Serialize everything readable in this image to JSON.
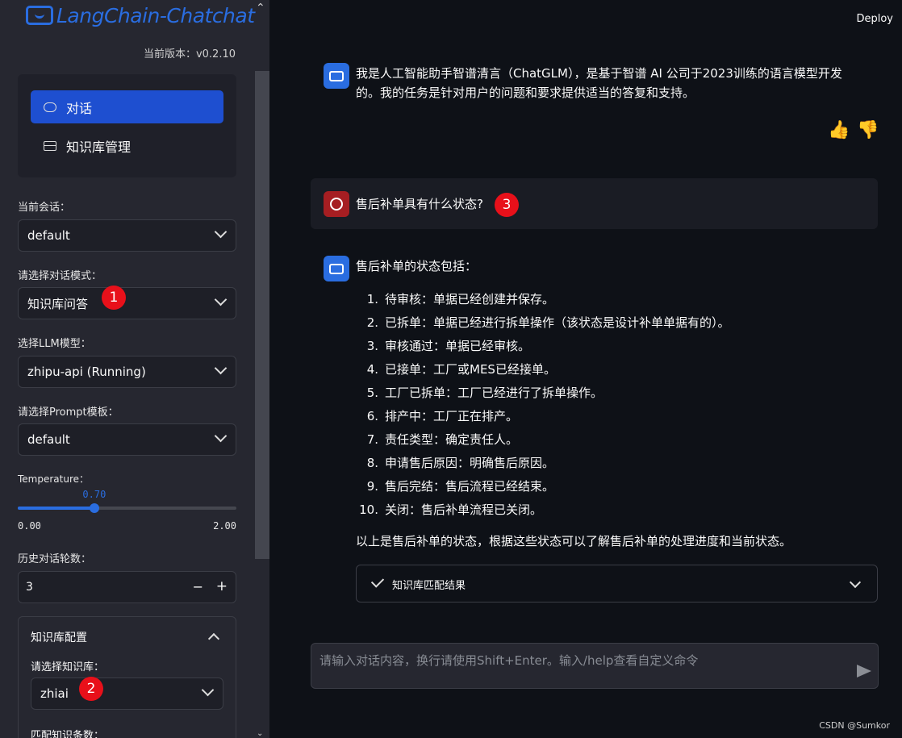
{
  "app": {
    "logo_text": "LangChain-Chatchat",
    "version": "当前版本：v0.2.10",
    "deploy_label": "Deploy"
  },
  "sidebar": {
    "nav": [
      {
        "label": "对话",
        "active": true,
        "icon": "chat-bubble-icon"
      },
      {
        "label": "知识库管理",
        "active": false,
        "icon": "database-icon"
      }
    ],
    "current_session_label": "当前会话：",
    "current_session_value": "default",
    "mode_label": "请选择对话模式：",
    "mode_value": "知识库问答",
    "llm_label": "选择LLM模型：",
    "llm_value": "zhipu-api (Running)",
    "prompt_label": "请选择Prompt模板：",
    "prompt_value": "default",
    "temperature_label": "Temperature：",
    "temperature_value": "0.70",
    "temperature_min": "0.00",
    "temperature_max": "2.00",
    "temperature_fraction": 0.35,
    "history_label": "历史对话轮数：",
    "history_value": "3",
    "minus": "−",
    "plus": "+",
    "kb_config_title": "知识库配置",
    "kb_select_label": "请选择知识库：",
    "kb_value": "zhiai",
    "kb_match_label": "匹配知识条数："
  },
  "badges": [
    "1",
    "2",
    "3"
  ],
  "chat": {
    "intro": "我是人工智能助手智谱清言（ChatGLM），是基于智谱 AI 公司于2023训练的语言模型开发的。我的任务是针对用户的问题和要求提供适当的答复和支持。",
    "user_question": "售后补单具有什么状态?",
    "answer_intro": "售后补单的状态包括：",
    "answer_items": [
      {
        "num": "1.",
        "text": "待审核：单据已经创建并保存。"
      },
      {
        "num": "2.",
        "text": "已拆单：单据已经进行拆单操作（该状态是设计补单单据有的）。"
      },
      {
        "num": "3.",
        "text": "审核通过：单据已经审核。"
      },
      {
        "num": "4.",
        "text": "已接单：工厂或MES已经接单。"
      },
      {
        "num": "5.",
        "text": "工厂已拆单：工厂已经进行了拆单操作。"
      },
      {
        "num": "6.",
        "text": "排产中：工厂正在排产。"
      },
      {
        "num": "7.",
        "text": "责任类型：确定责任人。"
      },
      {
        "num": "8.",
        "text": "申请售后原因：明确售后原因。"
      },
      {
        "num": "9.",
        "text": "售后完结：售后流程已经结束。"
      },
      {
        "num": "10.",
        "text": "关闭：售后补单流程已关闭。"
      }
    ],
    "answer_outro": "以上是售后补单的状态，根据这些状态可以了解售后补单的处理进度和当前状态。",
    "kb_result_label": "知识库匹配结果",
    "input_placeholder": "请输入对话内容，换行请使用Shift+Enter。输入/help查看自定义命令",
    "thumbs_up": "👍",
    "thumbs_down": "👎"
  },
  "watermark": "CSDN @Sumkor",
  "colors": {
    "accent": "#2a6de0",
    "badge": "#e8101a",
    "user_avatar": "#a61e22",
    "bg": "#0e1117",
    "sidebar": "#262730"
  }
}
